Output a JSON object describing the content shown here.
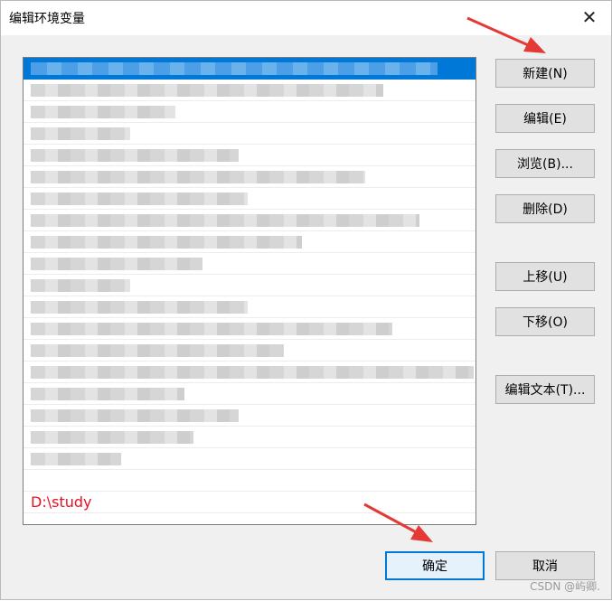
{
  "window": {
    "title": "编辑环境变量",
    "close_symbol": "✕"
  },
  "list": {
    "new_entry": "D:\\study"
  },
  "buttons": {
    "new": "新建(N)",
    "edit": "编辑(E)",
    "browse": "浏览(B)...",
    "delete": "删除(D)",
    "move_up": "上移(U)",
    "move_down": "下移(O)",
    "edit_text": "编辑文本(T)...",
    "ok": "确定",
    "cancel": "取消"
  },
  "watermark": "CSDN @屿卿.",
  "colors": {
    "selection": "#0078d7",
    "annotation_arrow": "#e53935",
    "new_entry_text": "#e81123"
  }
}
